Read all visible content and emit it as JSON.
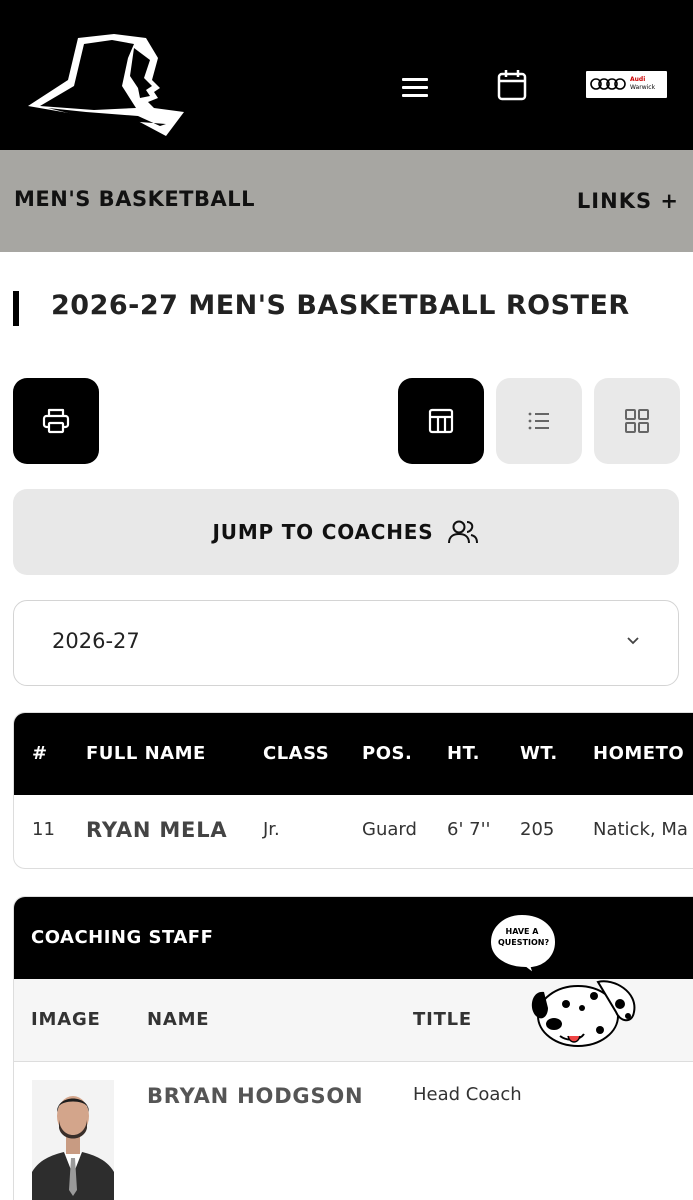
{
  "header": {
    "logo": "friar-logo-icon",
    "menu_icon": "hamburger-icon",
    "calendar_icon": "calendar-icon",
    "sponsor": {
      "brand": "Audi",
      "location": "Warwick"
    }
  },
  "sport_nav": {
    "title": "MEN'S BASKETBALL",
    "links_label": "LINKS +"
  },
  "page": {
    "title": "2026-27 MEN'S BASKETBALL ROSTER"
  },
  "toolbar": {
    "print_icon": "printer-icon",
    "views": [
      {
        "icon": "table-view-icon",
        "active": true
      },
      {
        "icon": "list-view-icon",
        "active": false
      },
      {
        "icon": "grid-view-icon",
        "active": false
      }
    ]
  },
  "jump": {
    "label": "JUMP TO COACHES",
    "icon": "users-icon"
  },
  "season_select": {
    "value": "2026-27",
    "icon": "chevron-down-icon"
  },
  "roster": {
    "headers": [
      "#",
      "FULL NAME",
      "CLASS",
      "POS.",
      "HT.",
      "WT.",
      "HOMETO"
    ],
    "rows": [
      {
        "number": "11",
        "name": "RYAN MELA",
        "class": "Jr.",
        "pos": "Guard",
        "ht": "6' 7''",
        "wt": "205",
        "hometown": "Natick, Ma"
      }
    ]
  },
  "staff": {
    "title": "COACHING STAFF",
    "headers": [
      "IMAGE",
      "NAME",
      "TITLE"
    ],
    "rows": [
      {
        "name": "BRYAN HODGSON",
        "title": "Head Coach"
      }
    ]
  },
  "chat_widget": {
    "text": "HAVE A QUESTION?",
    "icon": "dalmatian-icon"
  },
  "colors": {
    "header_bg": "#000000",
    "sport_bar_bg": "#a7a6a2",
    "button_bg": "#e9e9e9"
  }
}
